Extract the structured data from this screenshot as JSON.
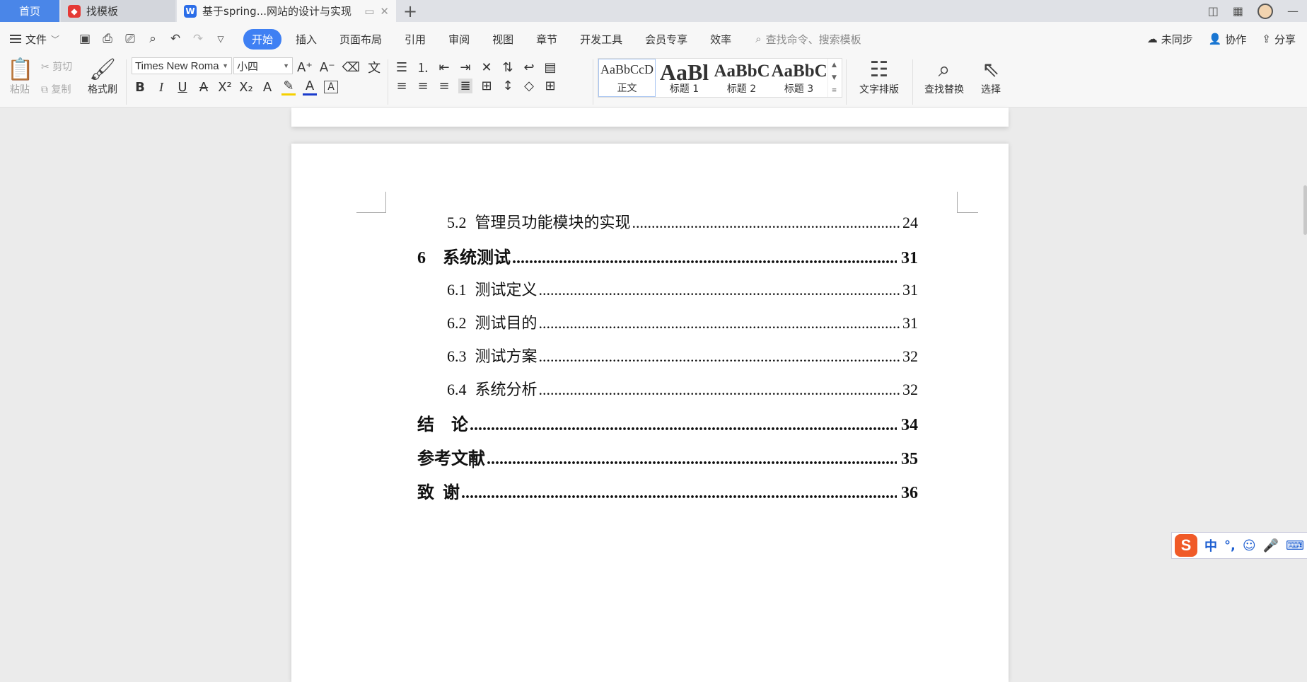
{
  "tabs": {
    "home": "首页",
    "templates": "找模板",
    "document": "基于spring...网站的设计与实现"
  },
  "menubar": {
    "file": "文件",
    "items": [
      "开始",
      "插入",
      "页面布局",
      "引用",
      "审阅",
      "视图",
      "章节",
      "开发工具",
      "会员专享",
      "效率"
    ],
    "active": "开始",
    "search_placeholder": "查找命令、搜索模板",
    "sync": "未同步",
    "collab": "协作",
    "share": "分享"
  },
  "ribbon": {
    "paste": "粘贴",
    "cut": "剪切",
    "copy": "复制",
    "format_painter": "格式刷",
    "font_name": "Times New Roma",
    "font_size": "小四",
    "styles": [
      {
        "preview": "AaBbCcD",
        "name": "正文"
      },
      {
        "preview": "AaBl",
        "name": "标题 1"
      },
      {
        "preview": "AaBbC",
        "name": "标题 2"
      },
      {
        "preview": "AaBbC",
        "name": "标题 3"
      }
    ],
    "text_layout": "文字排版",
    "find_replace": "查找替换",
    "select": "选择"
  },
  "toc": [
    {
      "level": 2,
      "num": "5.2",
      "title": "管理员功能模块的实现",
      "page": "24"
    },
    {
      "level": 1,
      "num": "6",
      "title": "系统测试",
      "page": "31"
    },
    {
      "level": 2,
      "num": "6.1",
      "title": "测试定义",
      "page": "31"
    },
    {
      "level": 2,
      "num": "6.2",
      "title": "测试目的",
      "page": "31"
    },
    {
      "level": 2,
      "num": "6.3",
      "title": "测试方案",
      "page": "32"
    },
    {
      "level": 2,
      "num": "6.4",
      "title": "系统分析",
      "page": "32"
    },
    {
      "level": 1,
      "num": "",
      "title": "结　论",
      "page": "34"
    },
    {
      "level": 1,
      "num": "",
      "title": "参考文献",
      "page": "35"
    },
    {
      "level": 1,
      "num": "",
      "title": "致  谢",
      "page": "36"
    }
  ],
  "ime": {
    "lang": "中",
    "punct": "°,"
  }
}
